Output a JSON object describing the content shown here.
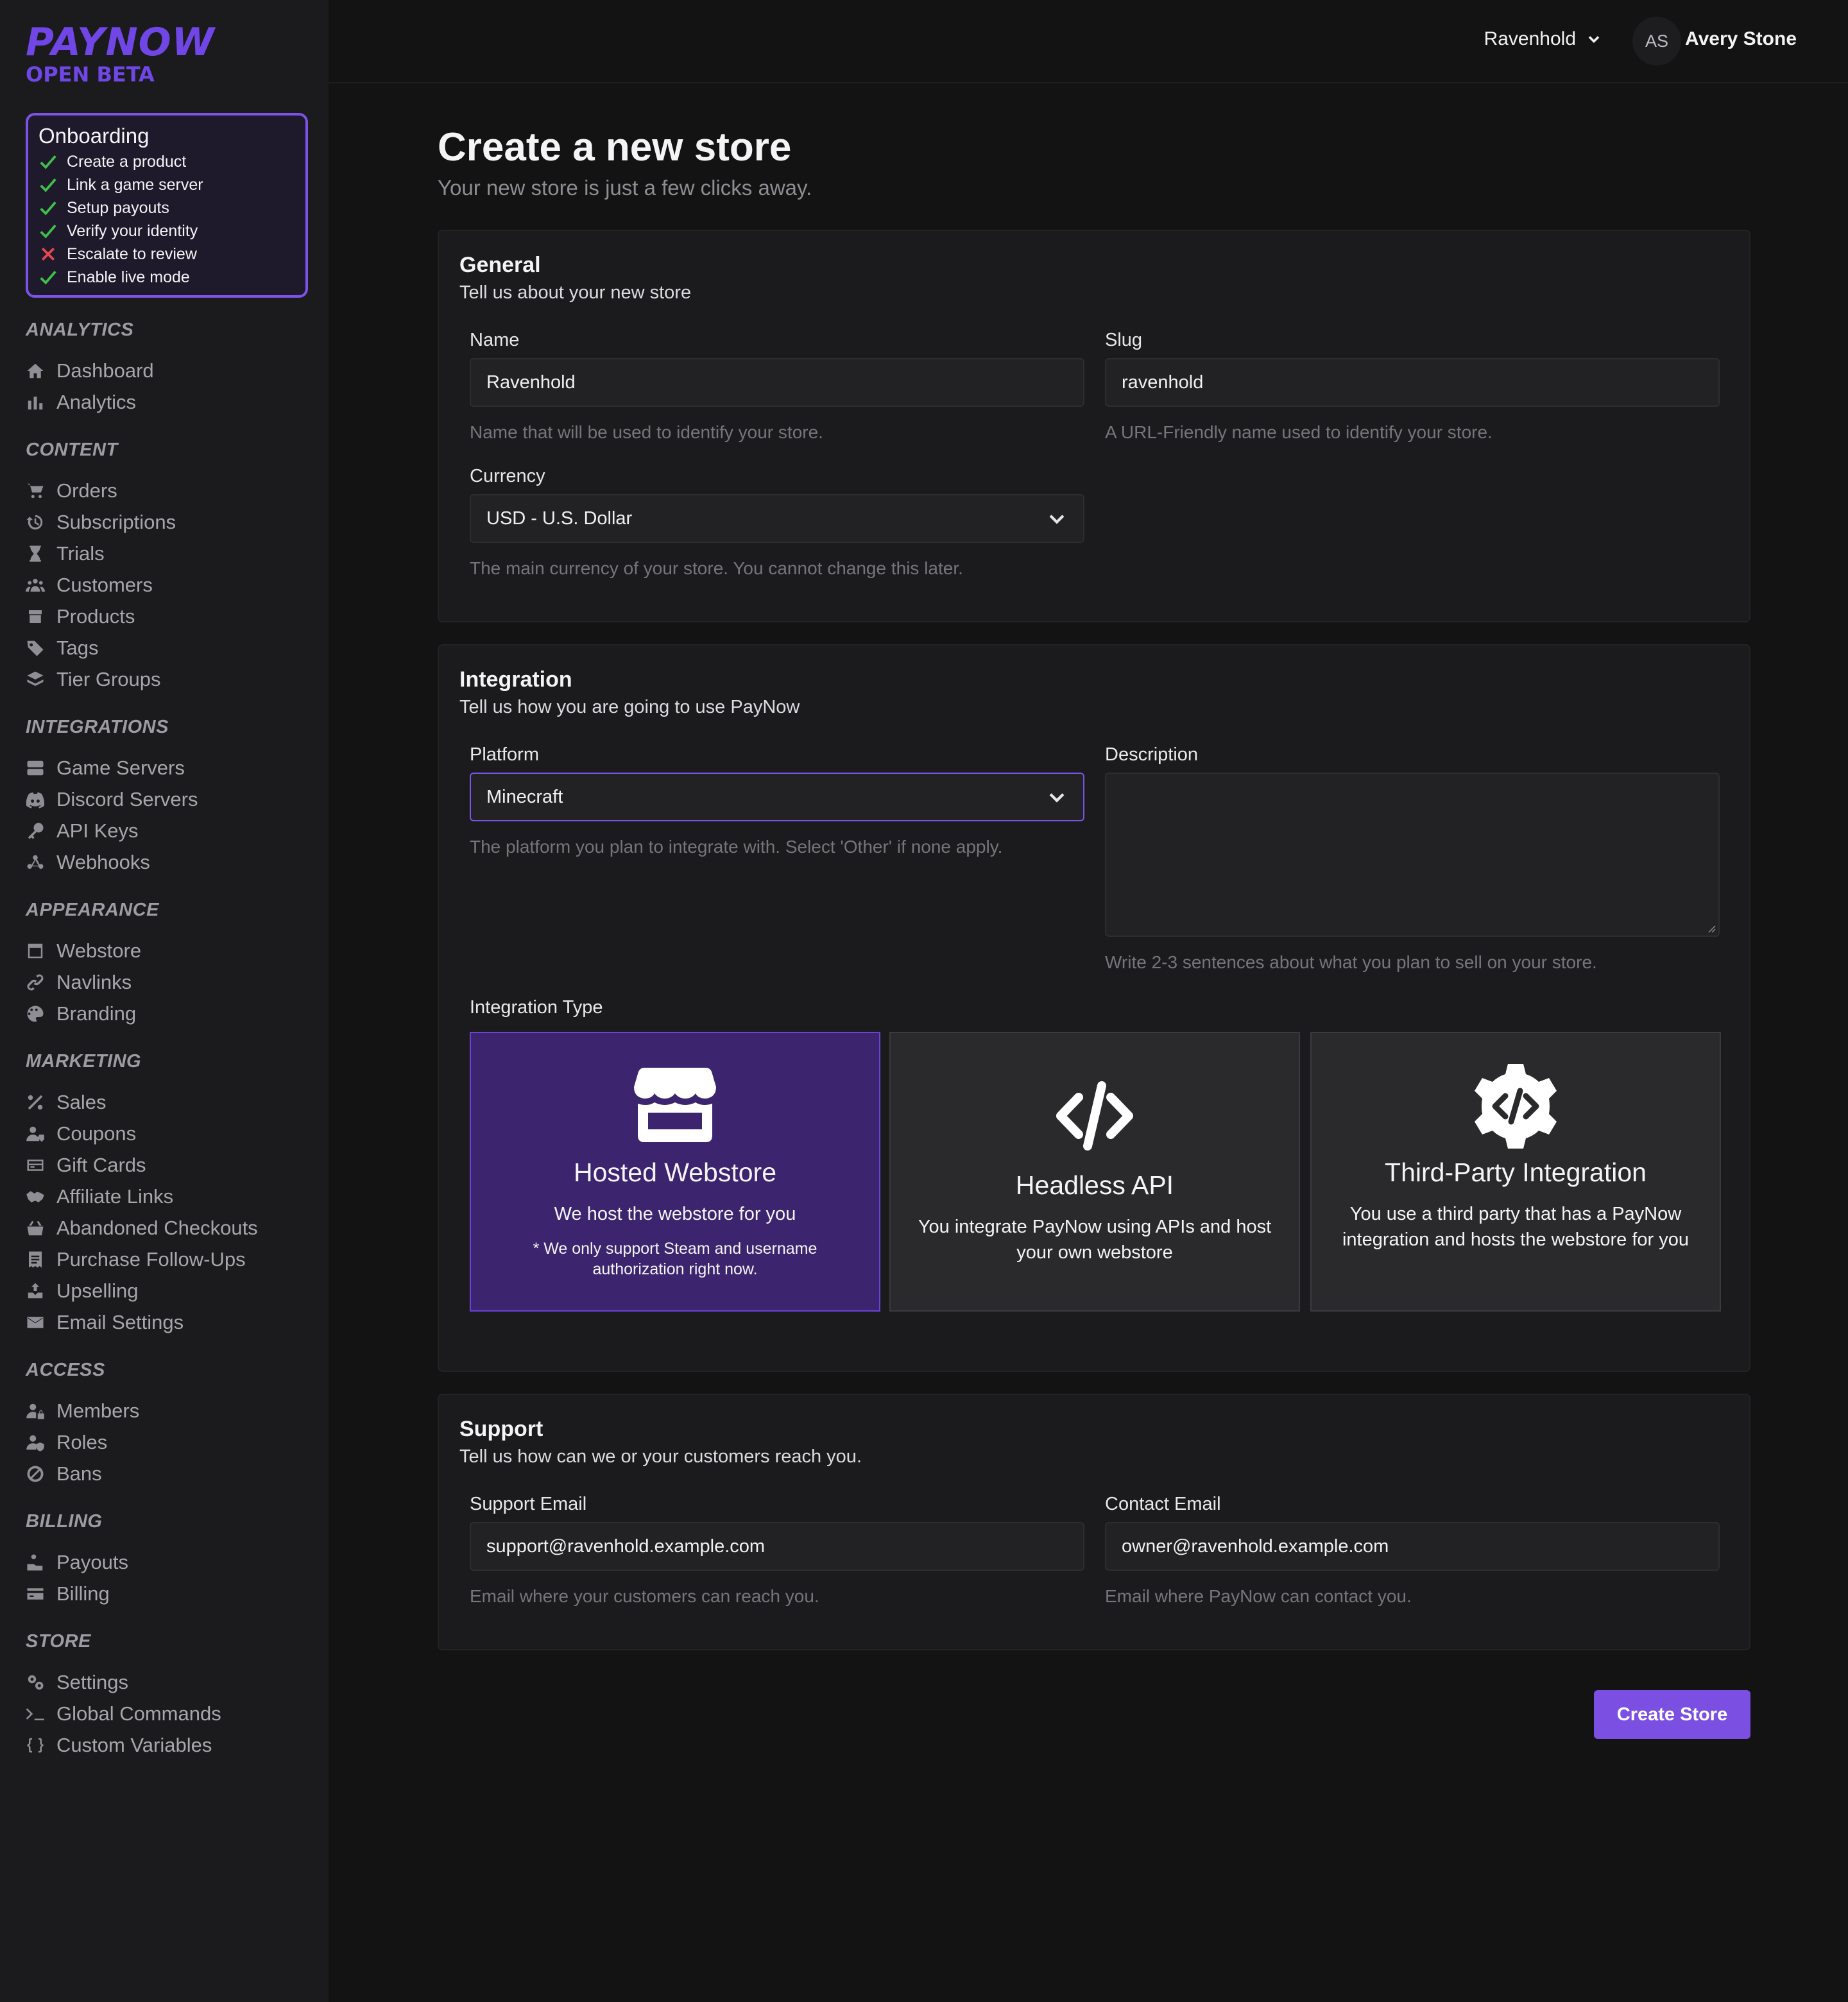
{
  "brand": {
    "name": "PAYNOW",
    "tag": "OPEN BETA",
    "accent": "#7047e6"
  },
  "onboarding": {
    "title": "Onboarding",
    "items": [
      {
        "label": "Create a product",
        "status": "done"
      },
      {
        "label": "Link a game server",
        "status": "done"
      },
      {
        "label": "Setup payouts",
        "status": "done"
      },
      {
        "label": "Verify your identity",
        "status": "done"
      },
      {
        "label": "Escalate to review",
        "status": "failed"
      },
      {
        "label": "Enable live mode",
        "status": "done"
      }
    ]
  },
  "sidebar": {
    "sections": [
      {
        "title": "ANALYTICS",
        "items": [
          {
            "label": "Dashboard",
            "icon": "home-icon"
          },
          {
            "label": "Analytics",
            "icon": "bar-chart-icon"
          }
        ]
      },
      {
        "title": "CONTENT",
        "items": [
          {
            "label": "Orders",
            "icon": "cart-icon"
          },
          {
            "label": "Subscriptions",
            "icon": "history-icon"
          },
          {
            "label": "Trials",
            "icon": "hourglass-icon"
          },
          {
            "label": "Customers",
            "icon": "users-icon"
          },
          {
            "label": "Products",
            "icon": "box-icon"
          },
          {
            "label": "Tags",
            "icon": "tags-icon"
          },
          {
            "label": "Tier Groups",
            "icon": "layers-icon"
          }
        ]
      },
      {
        "title": "INTEGRATIONS",
        "items": [
          {
            "label": "Game Servers",
            "icon": "server-icon"
          },
          {
            "label": "Discord Servers",
            "icon": "discord-icon"
          },
          {
            "label": "API Keys",
            "icon": "key-icon"
          },
          {
            "label": "Webhooks",
            "icon": "webhook-icon"
          }
        ]
      },
      {
        "title": "APPEARANCE",
        "items": [
          {
            "label": "Webstore",
            "icon": "window-icon"
          },
          {
            "label": "Navlinks",
            "icon": "link-icon"
          },
          {
            "label": "Branding",
            "icon": "palette-icon"
          }
        ]
      },
      {
        "title": "MARKETING",
        "items": [
          {
            "label": "Sales",
            "icon": "percent-icon"
          },
          {
            "label": "Coupons",
            "icon": "user-tag-icon"
          },
          {
            "label": "Gift Cards",
            "icon": "gift-card-icon"
          },
          {
            "label": "Affiliate Links",
            "icon": "handshake-icon"
          },
          {
            "label": "Abandoned Checkouts",
            "icon": "basket-icon"
          },
          {
            "label": "Purchase Follow-Ups",
            "icon": "receipt-icon"
          },
          {
            "label": "Upselling",
            "icon": "upsell-icon"
          },
          {
            "label": "Email Settings",
            "icon": "envelope-icon"
          }
        ]
      },
      {
        "title": "ACCESS",
        "items": [
          {
            "label": "Members",
            "icon": "user-lock-icon"
          },
          {
            "label": "Roles",
            "icon": "user-shield-icon"
          },
          {
            "label": "Bans",
            "icon": "ban-icon"
          }
        ]
      },
      {
        "title": "BILLING",
        "items": [
          {
            "label": "Payouts",
            "icon": "payout-icon"
          },
          {
            "label": "Billing",
            "icon": "credit-card-icon"
          }
        ]
      },
      {
        "title": "STORE",
        "items": [
          {
            "label": "Settings",
            "icon": "gears-icon"
          },
          {
            "label": "Global Commands",
            "icon": "terminal-icon"
          },
          {
            "label": "Custom Variables",
            "icon": "braces-icon"
          }
        ]
      }
    ]
  },
  "topbar": {
    "store": "Ravenhold",
    "avatar_initials": "AS",
    "user": "Avery Stone"
  },
  "page": {
    "title": "Create a new store",
    "subtitle": "Your new store is just a few clicks away."
  },
  "general": {
    "title": "General",
    "subtitle": "Tell us about your new store",
    "name": {
      "label": "Name",
      "value": "Ravenhold",
      "help": "Name that will be used to identify your store."
    },
    "slug": {
      "label": "Slug",
      "value": "ravenhold",
      "help": "A URL-Friendly name used to identify your store."
    },
    "currency": {
      "label": "Currency",
      "value": "USD - U.S. Dollar",
      "help": "The main currency of your store. You cannot change this later."
    }
  },
  "integration": {
    "title": "Integration",
    "subtitle": "Tell us how you are going to use PayNow",
    "platform": {
      "label": "Platform",
      "value": "Minecraft",
      "help": "The platform you plan to integrate with. Select 'Other' if none apply."
    },
    "description": {
      "label": "Description",
      "value": "",
      "help": "Write 2-3 sentences about what you plan to sell on your store."
    },
    "type_label": "Integration Type",
    "types": [
      {
        "title": "Hosted Webstore",
        "desc": "We host the webstore for you",
        "note": "* We only support Steam and username authorization right now.",
        "icon": "storefront-icon",
        "selected": true
      },
      {
        "title": "Headless API",
        "desc": "You integrate PayNow using APIs and host your own webstore",
        "icon": "code-icon",
        "selected": false
      },
      {
        "title": "Third-Party Integration",
        "desc": "You use a third party that has a PayNow integration and hosts the webstore for you",
        "icon": "code-gear-icon",
        "selected": false
      }
    ]
  },
  "support": {
    "title": "Support",
    "subtitle": "Tell us how can we or your customers reach you.",
    "support_email": {
      "label": "Support Email",
      "value": "support@ravenhold.example.com",
      "help": "Email where your customers can reach you."
    },
    "contact_email": {
      "label": "Contact Email",
      "value": "owner@ravenhold.example.com",
      "help": "Email where PayNow can contact you."
    }
  },
  "actions": {
    "create": "Create Store"
  }
}
